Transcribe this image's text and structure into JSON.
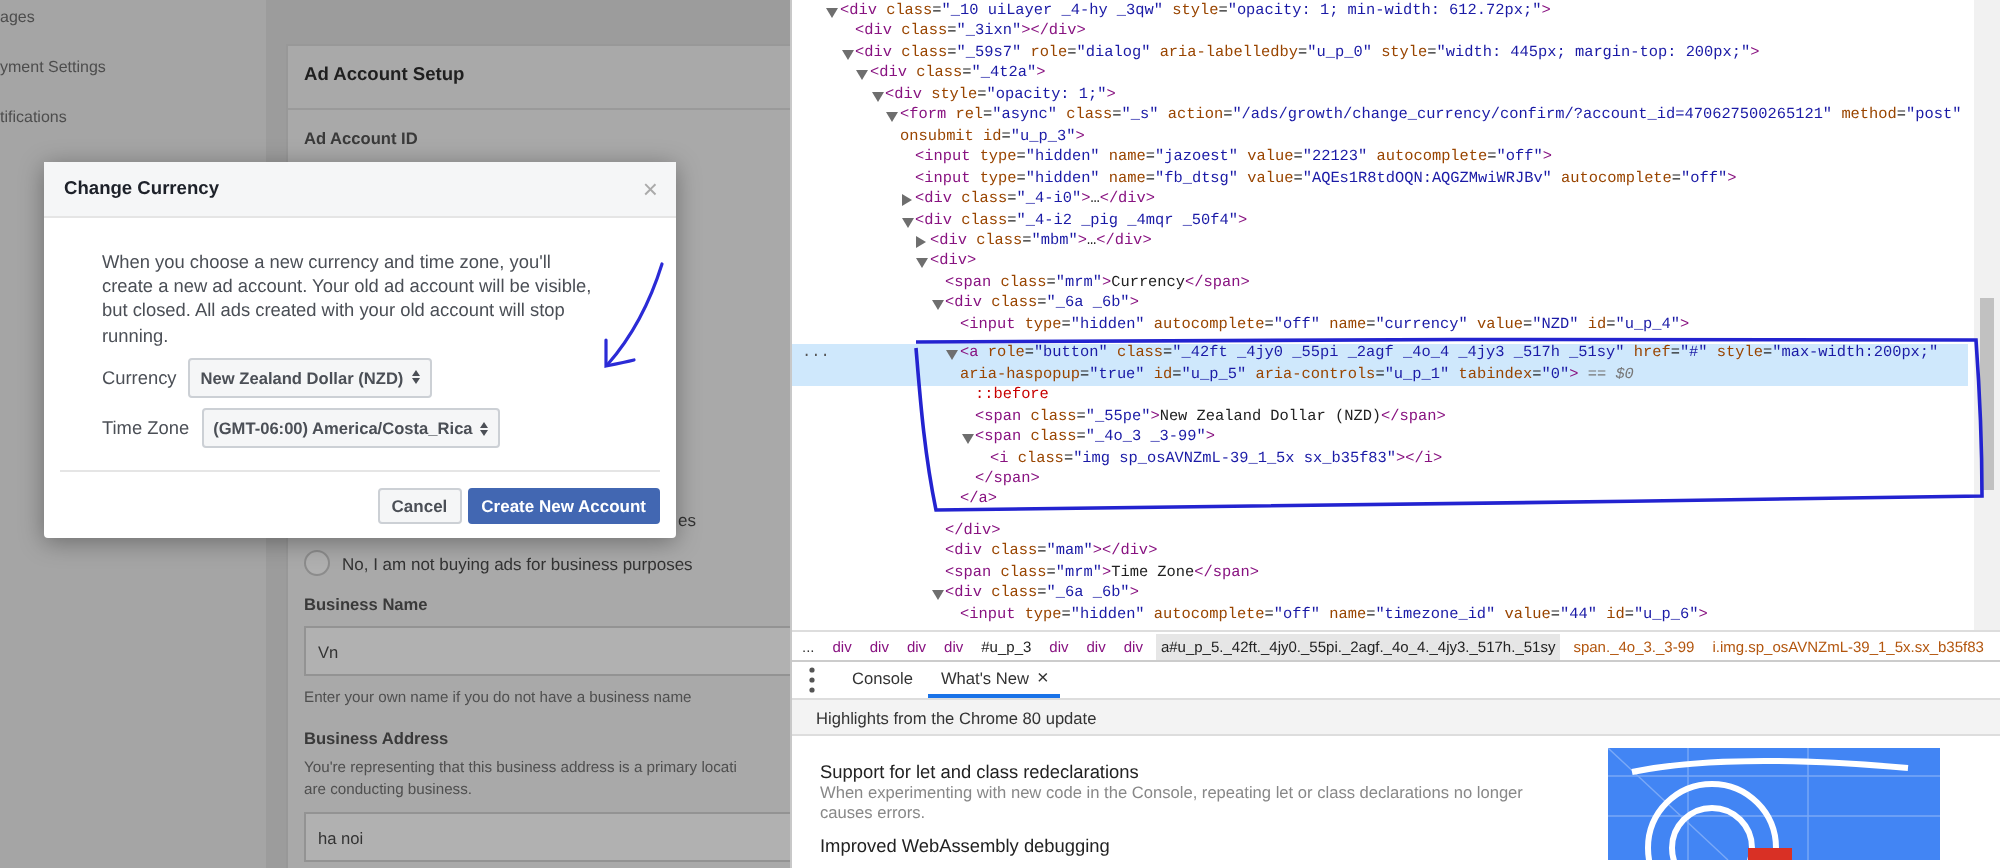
{
  "sidebar": {
    "items": [
      "ages",
      "yment Settings",
      "tifications"
    ]
  },
  "card": {
    "title": "Ad Account Setup",
    "account_id_label": "Ad Account ID",
    "covered_option_fragment": "es",
    "options": [
      {
        "label": "No, I am not buying ads for business purposes",
        "selected": false
      }
    ],
    "business_name": {
      "label": "Business Name",
      "value": "Vn",
      "help": "Enter your own name if you do not have a business name"
    },
    "business_address": {
      "label": "Business Address",
      "help_lines": [
        "You're representing that this business address is a primary locati",
        "are conducting business."
      ],
      "value": "ha noi"
    }
  },
  "modal": {
    "title": "Change Currency",
    "close": "×",
    "body": "When you choose a new currency and time zone, you'll create a new ad account. Your old ad account will be visible, but closed. All ads created with your old account will stop running.",
    "fields": [
      {
        "label": "Currency",
        "value": "New Zealand Dollar (NZD)"
      },
      {
        "label": "Time Zone",
        "value": "(GMT-06:00) America/Costa_Rica"
      }
    ],
    "buttons": [
      {
        "label": "Cancel",
        "kind": "secondary"
      },
      {
        "label": "Create New Account",
        "kind": "primary"
      }
    ]
  },
  "devtools": {
    "elements": [
      {
        "text": "<div class=\"_10 uiLayer _4-hy _3qw\" style=\"opacity: 1; min-width: 612.72px;\">",
        "expanded": true,
        "selected": false,
        "children": [
          {
            "text": "<div class=\"_3ixn\"></div>",
            "selected": false
          },
          {
            "text": "<div class=\"_59s7\" role=\"dialog\" aria-labelledby=\"u_p_0\" style=\"width: 445px; margin-top: 200px;\">",
            "expanded": true,
            "selected": false,
            "children": [
              {
                "text": "<div class=\"_4t2a\">",
                "expanded": true,
                "selected": false,
                "children": [
                  {
                    "text": "<div style=\"opacity: 1;\">",
                    "expanded": true,
                    "selected": false,
                    "children": [
                      {
                        "text": "<form rel=\"async\" class=\"_s\" action=\"/ads/growth/change_currency/confirm/?account_id=470627500265121\" method=\"post\" onsubmit id=\"u_p_3\">",
                        "expanded": true,
                        "selected": false,
                        "children": [
                          {
                            "text": "<input type=\"hidden\" name=\"jazoest\" value=\"22123\" autocomplete=\"off\">",
                            "selected": false
                          },
                          {
                            "text": "<input type=\"hidden\" name=\"fb_dtsg\" value=\"AQEs1R8tdOQN:AQGZMwiWRJBv\" autocomplete=\"off\">",
                            "selected": false
                          },
                          {
                            "text": "<div class=\"_4-i0\">…</div>",
                            "expanded": false,
                            "selected": false
                          },
                          {
                            "text": "<div class=\"_4-i2 _pig _4mqr _50f4\">",
                            "expanded": true,
                            "selected": false,
                            "children": [
                              {
                                "text": "<div class=\"mbm\">…</div>",
                                "expanded": false,
                                "selected": false
                              },
                              {
                                "text": "<div>",
                                "expanded": true,
                                "selected": false,
                                "children": [
                                  {
                                    "text": "<span class=\"mrm\">Currency</span>",
                                    "selected": false
                                  },
                                  {
                                    "text": "<div class=\"_6a _6b\">",
                                    "expanded": true,
                                    "selected": false,
                                    "close": "</div>",
                                    "children": [
                                      {
                                        "text": "<input type=\"hidden\" autocomplete=\"off\" name=\"currency\" value=\"NZD\" id=\"u_p_4\">",
                                        "selected": false
                                      },
                                      {
                                        "text": "<a role=\"button\" class=\"_42ft _4jy0 _55pi _2agf _4o_4 _4jy3 _517h _51sy\" href=\"#\" style=\"max-width:200px;\" aria-haspopup=\"true\" id=\"u_p_5\" aria-controls=\"u_p_1\" tabindex=\"0\">",
                                        "expanded": true,
                                        "selected": true,
                                        "gutter": "...",
                                        "console_ref": "== $0",
                                        "close": "</a>",
                                        "children": [
                                          {
                                            "text": "::before",
                                            "selected": false
                                          },
                                          {
                                            "text": "<span class=\"_55pe\">New Zealand Dollar (NZD)</span>",
                                            "selected": false
                                          },
                                          {
                                            "text": "<span class=\"_4o_3 _3-99\">",
                                            "expanded": true,
                                            "selected": false,
                                            "close": "</span>",
                                            "children": [
                                              {
                                                "text": "<i class=\"img sp_osAVNZmL-39_1_5x sx_b35f83\"></i>",
                                                "selected": false
                                              }
                                            ]
                                          }
                                        ]
                                      }
                                    ]
                                  },
                                  {
                                    "text": "<div class=\"mam\"></div>",
                                    "selected": false
                                  },
                                  {
                                    "text": "<span class=\"mrm\">Time Zone</span>",
                                    "selected": false
                                  },
                                  {
                                    "text": "<div class=\"_6a _6b\">",
                                    "expanded": true,
                                    "selected": false,
                                    "children": [
                                      {
                                        "text": "<input type=\"hidden\" autocomplete=\"off\" name=\"timezone_id\" value=\"44\" id=\"u_p_6\">",
                                        "selected": false
                                      }
                                    ]
                                  }
                                ]
                              }
                            ]
                          }
                        ]
                      }
                    ]
                  }
                ]
              }
            ]
          }
        ]
      }
    ],
    "breadcrumbs": [
      {
        "label": "...",
        "kind": "more",
        "selected": false
      },
      {
        "label": "div",
        "kind": "tag",
        "selected": false
      },
      {
        "label": "div",
        "kind": "tag",
        "selected": false
      },
      {
        "label": "div",
        "kind": "tag",
        "selected": false
      },
      {
        "label": "div",
        "kind": "tag",
        "selected": false
      },
      {
        "label": "#u_p_3",
        "kind": "id",
        "selected": false
      },
      {
        "label": "div",
        "kind": "tag",
        "selected": false
      },
      {
        "label": "div",
        "kind": "tag",
        "selected": false
      },
      {
        "label": "div",
        "kind": "tag",
        "selected": false
      },
      {
        "label": "a#u_p_5._42ft._4jy0._55pi._2agf._4o_4._4jy3._517h._51sy",
        "kind": "id",
        "selected": true
      },
      {
        "label": "span._4o_3._3-99",
        "kind": "class",
        "selected": false
      },
      {
        "label": "i.img.sp_osAVNZmL-39_1_5x.sx_b35f83",
        "kind": "class",
        "selected": false
      }
    ],
    "drawer": {
      "tabs": [
        {
          "label": "Console",
          "selected": false
        },
        {
          "label": "What's New",
          "selected": true,
          "close": "×"
        }
      ],
      "banner": "Highlights from the Chrome 80 update",
      "features": [
        {
          "title": "Support for let and class redeclarations",
          "description": "When experimenting with new code in the Console, repeating let or class declarations no longer causes errors."
        },
        {
          "title": "Improved WebAssembly debugging"
        }
      ]
    }
  }
}
